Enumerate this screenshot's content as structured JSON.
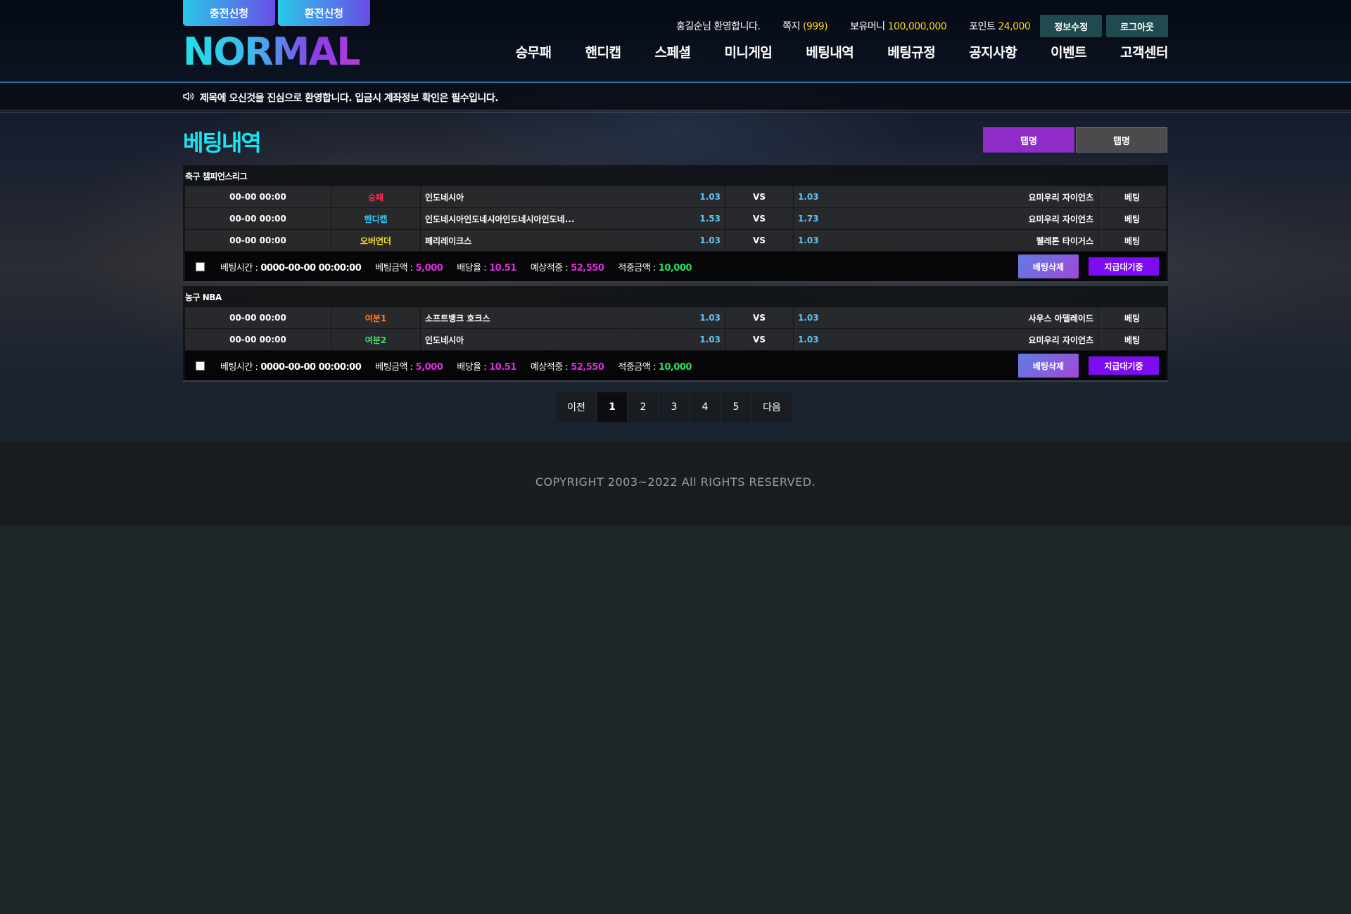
{
  "header": {
    "charge_btn": "충전신청",
    "exchange_btn": "환전신청",
    "logo": "NORMAL",
    "welcome": "홍길순님 환영합니다.",
    "memo_label": "쪽지",
    "memo_count": "(999)",
    "money_label": "보유머니",
    "money_value": "100,000,000",
    "point_label": "포인트",
    "point_value": "24,000",
    "edit_btn": "정보수정",
    "logout_btn": "로그아웃",
    "nav": [
      "승무패",
      "핸디캡",
      "스페셜",
      "미니게임",
      "베팅내역",
      "베팅규정",
      "공지사항",
      "이벤트",
      "고객센터"
    ]
  },
  "notice": "제목에 오신것을 진심으로 환영합니다. 입금시 계좌정보 확인은 필수입니다.",
  "page": {
    "title": "베팅내역",
    "tab1": "탭명",
    "tab2": "탭명"
  },
  "bets": [
    {
      "league": "축구 챔피언스리그",
      "rows": [
        {
          "time": "00-00 00:00",
          "type": "승패",
          "home": "인도네시아",
          "home_odd": "1.03",
          "vs": "VS",
          "away_odd": "1.03",
          "away": "요미우리 자이언츠",
          "bet": "베팅"
        },
        {
          "time": "00-00 00:00",
          "type": "핸디캡",
          "home": "인도네시아인도네시아인도네시아인도네...",
          "home_odd": "1.53",
          "vs": "VS",
          "away_odd": "1.73",
          "away": "요미우리 자이언츠",
          "bet": "베팅"
        },
        {
          "time": "00-00 00:00",
          "type": "오버언더",
          "home": "페리레이크스",
          "home_odd": "1.03",
          "vs": "VS",
          "away_odd": "1.03",
          "away": "웰레톤 타이거스",
          "bet": "베팅"
        }
      ],
      "summary": {
        "time_label": "베팅시간 :",
        "time_value": "0000-00-00 00:00:00",
        "amount_label": "베팅금액 :",
        "amount_value": "5,000",
        "rate_label": "배당율 :",
        "rate_value": "10.51",
        "expect_label": "예상적중 :",
        "expect_value": "52,550",
        "hit_label": "적중금액 :",
        "hit_value": "10,000",
        "del_btn": "베팅삭제",
        "pay_btn": "지급대기중"
      }
    },
    {
      "league": "농구 NBA",
      "rows": [
        {
          "time": "00-00 00:00",
          "type": "여분1",
          "home": "소프트뱅크 호크스",
          "home_odd": "1.03",
          "vs": "VS",
          "away_odd": "1.03",
          "away": "사우스 아델레이드",
          "bet": "베팅"
        },
        {
          "time": "00-00 00:00",
          "type": "여분2",
          "home": "인도네시아",
          "home_odd": "1.03",
          "vs": "VS",
          "away_odd": "1.03",
          "away": "요미우리 자이언츠",
          "bet": "베팅"
        }
      ],
      "summary": {
        "time_label": "베팅시간 :",
        "time_value": "0000-00-00 00:00:00",
        "amount_label": "베팅금액 :",
        "amount_value": "5,000",
        "rate_label": "배당율 :",
        "rate_value": "10.51",
        "expect_label": "예상적중 :",
        "expect_value": "52,550",
        "hit_label": "적중금액 :",
        "hit_value": "10,000",
        "del_btn": "베팅삭제",
        "pay_btn": "지급대기중"
      }
    }
  ],
  "pagination": {
    "prev": "이전",
    "pages": [
      "1",
      "2",
      "3",
      "4",
      "5"
    ],
    "next": "다음",
    "current": "1"
  },
  "footer": {
    "copyright": "COPYRIGHT 2003~2022 All RIGHTS RESERVED."
  },
  "colors": {
    "accent_cyan": "#17e6f0",
    "accent_purple": "#8f2cc8",
    "gold": "#ffd21e",
    "magenta": "#e02ce0",
    "green": "#25e25a"
  }
}
